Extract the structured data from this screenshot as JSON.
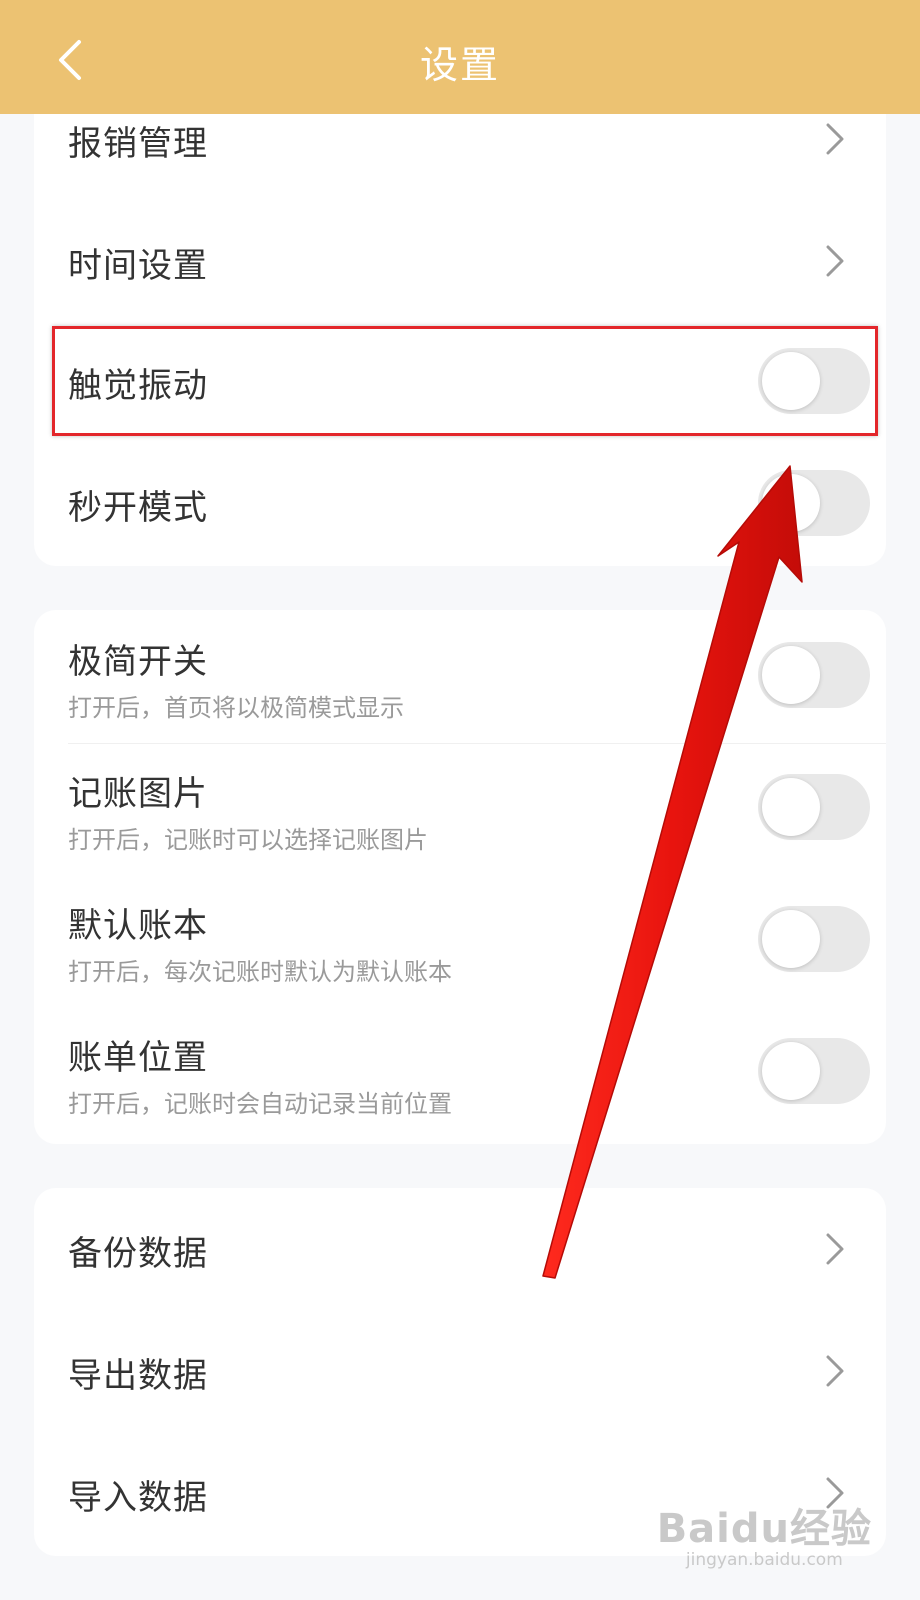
{
  "header": {
    "title": "设置",
    "back_icon": "chevron-left-icon",
    "bg": "#ecc272"
  },
  "group1": {
    "items": [
      {
        "label": "报销管理",
        "type": "link"
      },
      {
        "label": "时间设置",
        "type": "link"
      },
      {
        "label": "触觉振动",
        "type": "toggle",
        "on": false
      },
      {
        "label": "秒开模式",
        "type": "toggle",
        "on": false
      }
    ]
  },
  "group2": {
    "items": [
      {
        "label": "极简开关",
        "sub": "打开后，首页将以极简模式显示",
        "type": "toggle",
        "on": false
      },
      {
        "label": "记账图片",
        "sub": "打开后，记账时可以选择记账图片",
        "type": "toggle",
        "on": false
      },
      {
        "label": "默认账本",
        "sub": "打开后，每次记账时默认为默认账本",
        "type": "toggle",
        "on": false
      },
      {
        "label": "账单位置",
        "sub": "打开后，记账时会自动记录当前位置",
        "type": "toggle",
        "on": false
      }
    ]
  },
  "group3": {
    "items": [
      {
        "label": "备份数据",
        "type": "link"
      },
      {
        "label": "导出数据",
        "type": "link"
      },
      {
        "label": "导入数据",
        "type": "link"
      }
    ]
  },
  "annotation": {
    "color": "#e3262b",
    "target": "触觉振动"
  },
  "watermark": {
    "logo": "Baidu经验",
    "url": "jingyan.baidu.com"
  }
}
